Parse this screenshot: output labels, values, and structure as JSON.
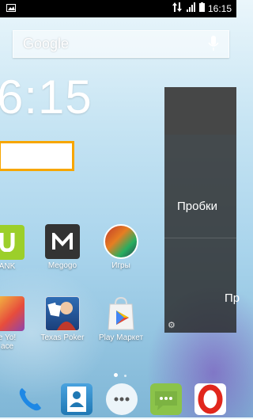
{
  "statusbar": {
    "time": "16:15"
  },
  "search": {
    "label": "Google"
  },
  "clock": {
    "time": "6:15"
  },
  "widget": {
    "label_traffic": "Пробки",
    "label_partial": "Пр"
  },
  "apps": {
    "ank": "ANK",
    "megogo": "Megogo",
    "games": "Игры",
    "ho_yo": "e Yo!\nace",
    "texas_poker": "Texas Poker",
    "play_market": "Play Маркет"
  },
  "colors": {
    "megogo_bg": "#333333",
    "green_app": "#9ccf2a",
    "accent_orange": "#f7a600"
  }
}
